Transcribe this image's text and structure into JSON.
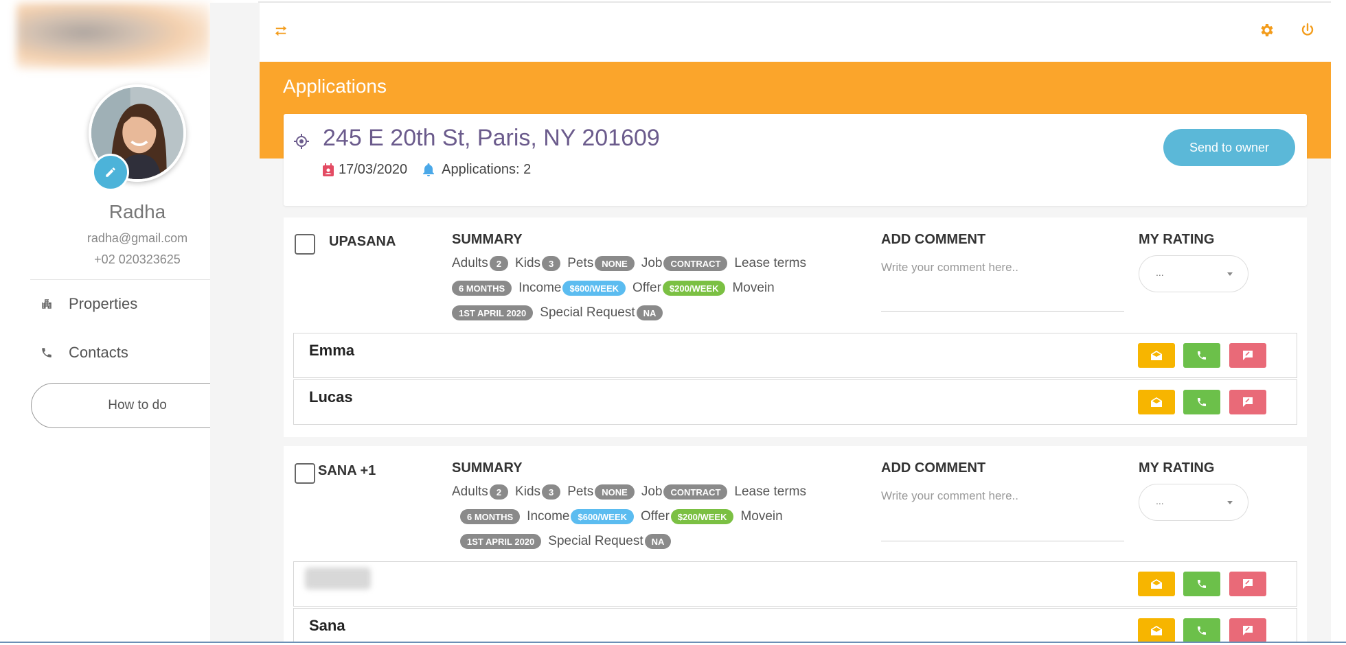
{
  "user": {
    "name": "Radha",
    "email": "radha@gmail.com",
    "phone": "+02 020323625"
  },
  "nav": [
    {
      "label": "Properties",
      "icon": "building-icon"
    },
    {
      "label": "Contacts",
      "icon": "phone-icon"
    }
  ],
  "how_to_label": "How to do",
  "header": {
    "title": "Applications"
  },
  "property": {
    "address": "245 E 20th St, Paris, NY 201609",
    "date": "17/03/2020",
    "applications": "Applications: 2",
    "send_label": "Send to owner"
  },
  "labels": {
    "summary": "SUMMARY",
    "add_comment": "ADD COMMENT",
    "my_rating": "MY RATING",
    "comment_placeholder": "Write your comment here..",
    "rating_value": "...",
    "adults": "Adults",
    "kids": "Kids",
    "pets": "Pets",
    "job": "Job",
    "lease_terms": "Lease terms",
    "income": "Income",
    "offer": "Offer",
    "movein": "Movein",
    "special_request": "Special Request"
  },
  "applications": [
    {
      "applicant": "UPASANA",
      "summary": {
        "adults": "2",
        "kids": "3",
        "pets": "NONE",
        "job": "CONTRACT",
        "lease": "6 MONTHS",
        "income": "$600/WEEK",
        "offer": "$200/WEEK",
        "movein": "1ST APRIL 2020",
        "special": "NA"
      },
      "people": [
        {
          "name": "Emma"
        },
        {
          "name": "Lucas"
        }
      ]
    },
    {
      "applicant": "SANA +1",
      "summary": {
        "adults": "2",
        "kids": "3",
        "pets": "NONE",
        "job": "CONTRACT",
        "lease": "6 MONTHS",
        "income": "$600/WEEK",
        "offer": "$200/WEEK",
        "movein": "1ST APRIL 2020",
        "special": "NA"
      },
      "people": [
        {
          "name": ""
        },
        {
          "name": "Sana"
        }
      ]
    }
  ],
  "colors": {
    "accent": "#fba52b",
    "primary_btn": "#5bb8d8",
    "address": "#6b5b8c",
    "mail": "#f7b500",
    "phone": "#6cc04a",
    "message": "#e96a78"
  }
}
